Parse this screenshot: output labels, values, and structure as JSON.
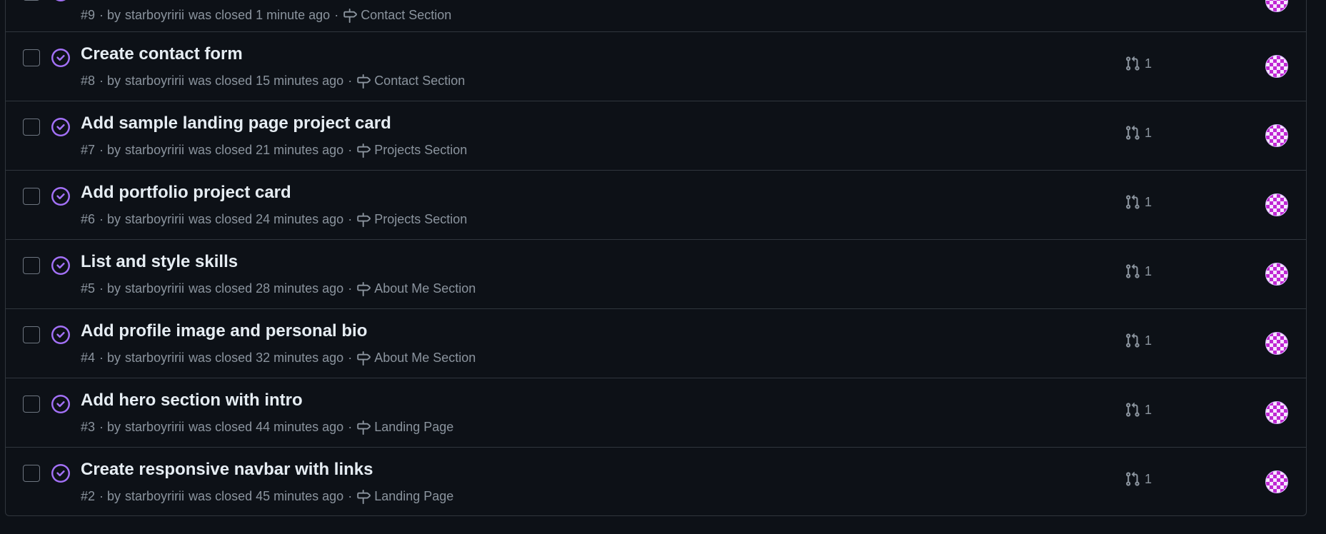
{
  "colors": {
    "background": "#0d1117",
    "border": "#30363d",
    "closed_icon": "#a371f7",
    "muted_text": "#8b949e",
    "title_text": "#e6edf3",
    "avatar_accent": "#c026d3"
  },
  "icons": {
    "state": "issue-closed-icon",
    "milestone": "milestone-icon",
    "linked_pr": "git-pull-request-icon"
  },
  "issues": [
    {
      "number": "#9",
      "title": "",
      "by_prefix": "· by",
      "author": "starboyririi",
      "status_text": "was closed 1 minute ago",
      "separator": "·",
      "milestone": "Contact Section",
      "linked_prs": ""
    },
    {
      "number": "#8",
      "title": "Create contact form",
      "by_prefix": "· by",
      "author": "starboyririi",
      "status_text": "was closed 15 minutes ago",
      "separator": "·",
      "milestone": "Contact Section",
      "linked_prs": "1"
    },
    {
      "number": "#7",
      "title": "Add sample landing page project card",
      "by_prefix": "· by",
      "author": "starboyririi",
      "status_text": "was closed 21 minutes ago",
      "separator": "·",
      "milestone": "Projects Section",
      "linked_prs": "1"
    },
    {
      "number": "#6",
      "title": "Add portfolio project card",
      "by_prefix": "· by",
      "author": "starboyririi",
      "status_text": "was closed 24 minutes ago",
      "separator": "·",
      "milestone": "Projects Section",
      "linked_prs": "1"
    },
    {
      "number": "#5",
      "title": "List and style skills",
      "by_prefix": "· by",
      "author": "starboyririi",
      "status_text": "was closed 28 minutes ago",
      "separator": "·",
      "milestone": "About Me Section",
      "linked_prs": "1"
    },
    {
      "number": "#4",
      "title": "Add profile image and personal bio",
      "by_prefix": "· by",
      "author": "starboyririi",
      "status_text": "was closed 32 minutes ago",
      "separator": "·",
      "milestone": "About Me Section",
      "linked_prs": "1"
    },
    {
      "number": "#3",
      "title": "Add hero section with intro",
      "by_prefix": "· by",
      "author": "starboyririi",
      "status_text": "was closed 44 minutes ago",
      "separator": "·",
      "milestone": "Landing Page",
      "linked_prs": "1"
    },
    {
      "number": "#2",
      "title": "Create responsive navbar with links",
      "by_prefix": "· by",
      "author": "starboyririi",
      "status_text": "was closed 45 minutes ago",
      "separator": "·",
      "milestone": "Landing Page",
      "linked_prs": "1"
    }
  ]
}
